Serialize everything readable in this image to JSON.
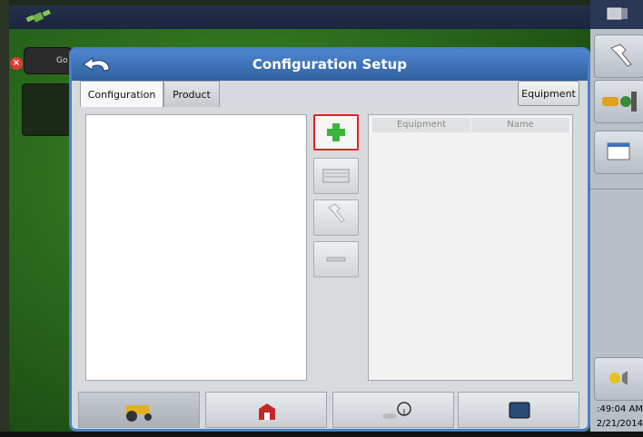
{
  "dialog": {
    "title": "Configuration Setup",
    "tabs": [
      {
        "label": "Configuration",
        "selected": true
      },
      {
        "label": "Product",
        "selected": false
      }
    ],
    "equipment_button": "Equipment",
    "table_headers": [
      "Equipment",
      "Name"
    ],
    "side_buttons": [
      "add-icon",
      "keyboard-icon",
      "wrench-icon",
      "minus-icon"
    ],
    "bottom_tabs": [
      "tractor-icon",
      "barn-icon",
      "steering-wheel-icon",
      "display-icon"
    ]
  },
  "background": {
    "alert_text": "Go"
  },
  "rightbar": {
    "time": ":49:04 AM",
    "date": "2/21/2014"
  },
  "colors": {
    "dialog_header": "#3f74bb",
    "highlight": "#e02424",
    "add_icon": "#3cb43c"
  }
}
